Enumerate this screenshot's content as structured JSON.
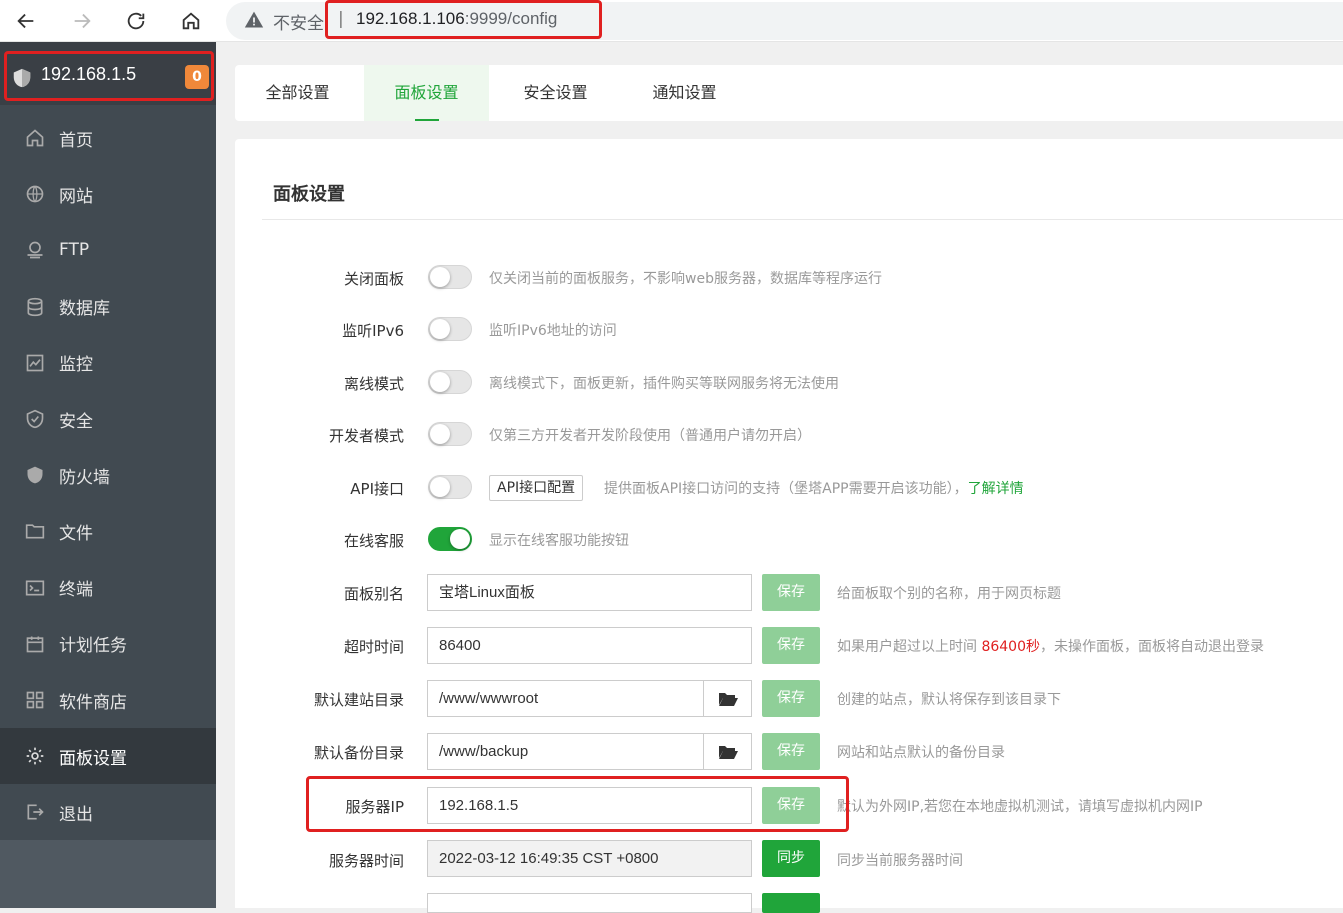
{
  "browser": {
    "insecure_label": "不安全",
    "separator": "|",
    "url_host": "192.168.1.106",
    "url_path": ":9999/config"
  },
  "sidebar": {
    "server_ip": "192.168.1.5",
    "badge_count": "0",
    "items": [
      {
        "label": "首页",
        "icon": "home-icon"
      },
      {
        "label": "网站",
        "icon": "globe-icon"
      },
      {
        "label": "FTP",
        "icon": "ftp-icon"
      },
      {
        "label": "数据库",
        "icon": "database-icon"
      },
      {
        "label": "监控",
        "icon": "monitor-icon"
      },
      {
        "label": "安全",
        "icon": "shield-check-icon"
      },
      {
        "label": "防火墙",
        "icon": "firewall-icon"
      },
      {
        "label": "文件",
        "icon": "folder-icon"
      },
      {
        "label": "终端",
        "icon": "terminal-icon"
      },
      {
        "label": "计划任务",
        "icon": "calendar-icon"
      },
      {
        "label": "软件商店",
        "icon": "apps-icon"
      },
      {
        "label": "面板设置",
        "icon": "gear-icon"
      },
      {
        "label": "退出",
        "icon": "logout-icon"
      }
    ],
    "active_index": 11
  },
  "tabs": [
    {
      "label": "全部设置"
    },
    {
      "label": "面板设置"
    },
    {
      "label": "安全设置"
    },
    {
      "label": "通知设置"
    }
  ],
  "main": {
    "title": "面板设置",
    "toggles": [
      {
        "label": "关闭面板",
        "on": false,
        "hint": "仅关闭当前的面板服务，不影响web服务器，数据库等程序运行"
      },
      {
        "label": "监听IPv6",
        "on": false,
        "hint": "监听IPv6地址的访问"
      },
      {
        "label": "离线模式",
        "on": false,
        "hint": "离线模式下，面板更新，插件购买等联网服务将无法使用"
      },
      {
        "label": "开发者模式",
        "on": false,
        "hint": "仅第三方开发者开发阶段使用（普通用户请勿开启）"
      },
      {
        "label": "API接口",
        "on": false,
        "button": "API接口配置",
        "hint": "提供面板API接口访问的支持（堡塔APP需要开启该功能），",
        "link": "了解详情"
      },
      {
        "label": "在线客服",
        "on": true,
        "hint": "显示在线客服功能按钮"
      }
    ],
    "fields": {
      "alias": {
        "label": "面板别名",
        "value": "宝塔Linux面板",
        "button": "保存",
        "hint": "给面板取个别的名称，用于网页标题"
      },
      "timeout": {
        "label": "超时时间",
        "value": "86400",
        "button": "保存",
        "hint_pre": "如果用户超过以上时间 ",
        "hint_value": "86400秒",
        "hint_post": "，未操作面板，面板将自动退出登录"
      },
      "site_dir": {
        "label": "默认建站目录",
        "value": "/www/wwwroot",
        "button": "保存",
        "hint": "创建的站点，默认将保存到该目录下"
      },
      "backup_dir": {
        "label": "默认备份目录",
        "value": "/www/backup",
        "button": "保存",
        "hint": "网站和站点默认的备份目录"
      },
      "server_ip": {
        "label": "服务器IP",
        "value": "192.168.1.5",
        "button": "保存",
        "hint": "默认为外网IP,若您在本地虚拟机测试，请填写虚拟机内网IP"
      },
      "server_time": {
        "label": "服务器时间",
        "value": "2022-03-12 16:49:35 CST +0800",
        "button": "同步",
        "hint": "同步当前服务器时间"
      }
    }
  },
  "colors": {
    "accent_green": "#20a53a",
    "sidebar_bg": "#414a51",
    "badge": "#f0883a",
    "highlight_red": "#e02020"
  }
}
